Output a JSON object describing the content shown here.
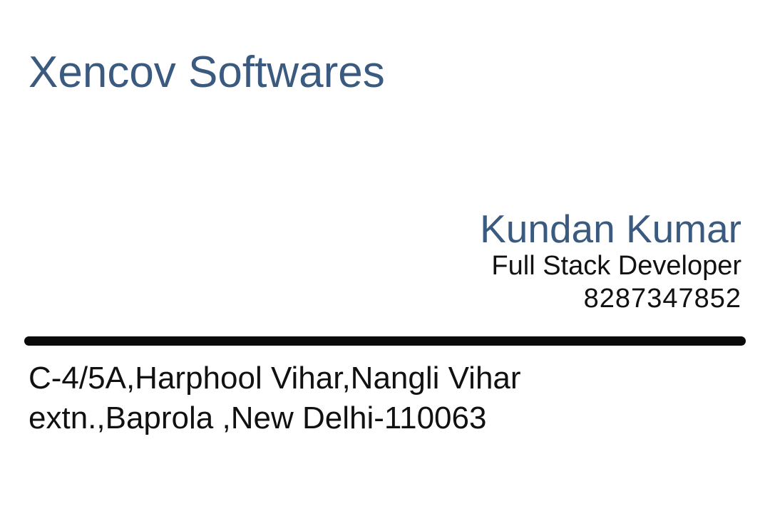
{
  "card": {
    "company_name": "Xencov Softwares",
    "person_name": "Kundan Kumar",
    "job_title": "Full Stack Developer",
    "phone": "8287347852",
    "address_line1": "C-4/5A,Harphool Vihar,Nangli Vihar",
    "address_line2": "extn.,Baprola ,New Delhi-110063"
  },
  "colors": {
    "accent": "#3a5a80",
    "text": "#111111",
    "background": "#ffffff",
    "divider": "#0a0a0a"
  }
}
